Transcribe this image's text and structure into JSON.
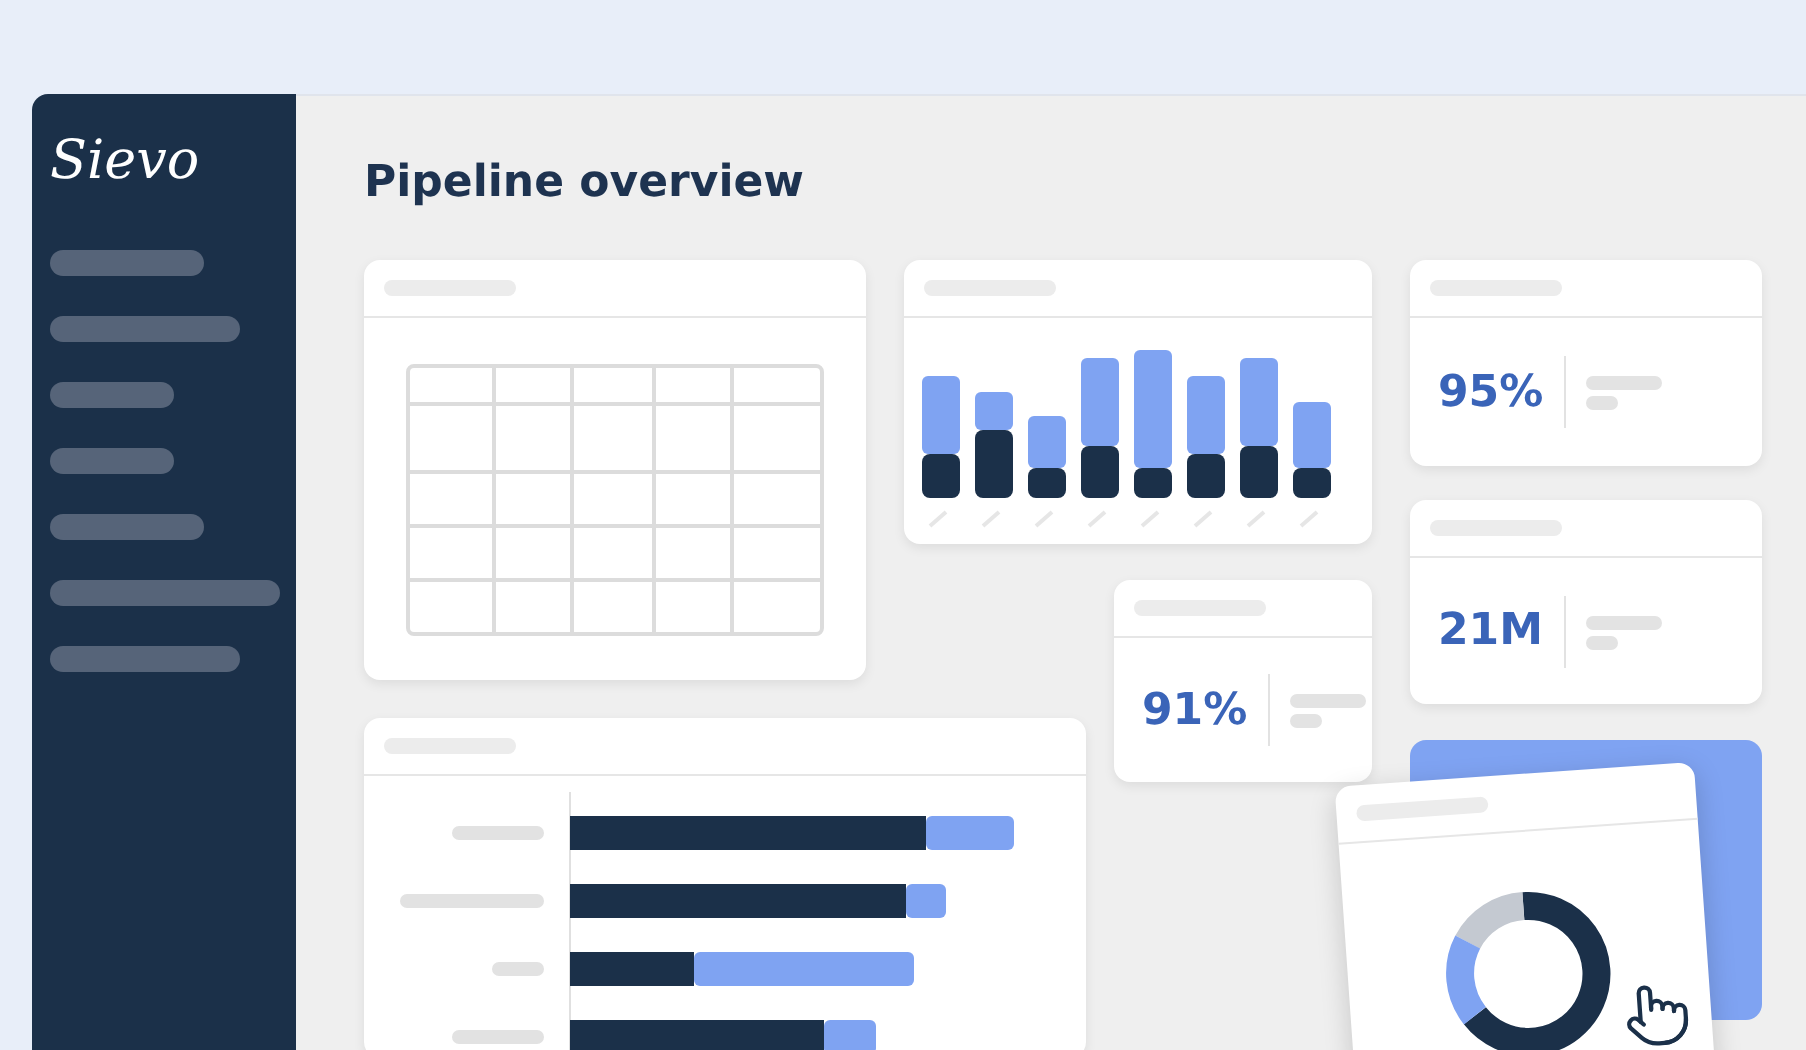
{
  "sidebar": {
    "logo": "Sievo"
  },
  "main": {
    "title": "Pipeline overview",
    "kpi_cards": [
      {
        "value": "95%"
      },
      {
        "value": "21M"
      },
      {
        "value": "91%"
      }
    ]
  }
}
